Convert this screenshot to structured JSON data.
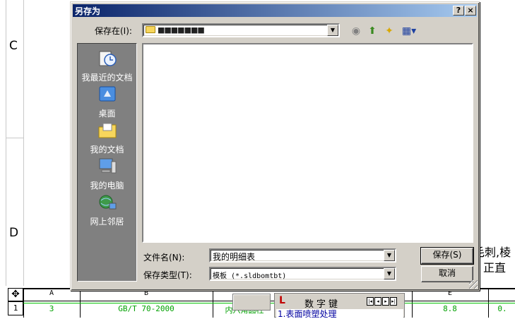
{
  "background": {
    "row_letters": [
      "C",
      "D"
    ],
    "side_note_line1": "毛刺,棱",
    "side_note_line2": "正直",
    "bom_headers": [
      "A",
      "B",
      "E"
    ],
    "bom_row": {
      "number": "1",
      "qty": "3",
      "standard": "GB/T 70-2000",
      "name": "内六角圆柱",
      "grade": "8.8",
      "last": "0."
    }
  },
  "keypad_toolbar": {
    "logo": "L",
    "title": "数字键",
    "nav": [
      "|◂",
      "◂",
      "▸",
      "▸|"
    ],
    "list_item": "1.表面喷塑处理"
  },
  "dialog": {
    "title": "另存为",
    "help_button": "?",
    "close_button": "×",
    "save_in_label": "保存在(I):",
    "save_in_value": "■■■■■■■",
    "places": [
      {
        "label": "我最近的文档",
        "icon": "recent-documents-icon"
      },
      {
        "label": "桌面",
        "icon": "desktop-icon"
      },
      {
        "label": "我的文档",
        "icon": "my-documents-icon"
      },
      {
        "label": "我的电脑",
        "icon": "my-computer-icon"
      },
      {
        "label": "网上邻居",
        "icon": "network-places-icon"
      }
    ],
    "filename_label": "文件名(N):",
    "filename_value": "我的明细表",
    "filetype_label": "保存类型(T):",
    "filetype_value": "模板 (*.sldbomtbt)",
    "save_button": "保存(S)",
    "cancel_button": "取消"
  }
}
